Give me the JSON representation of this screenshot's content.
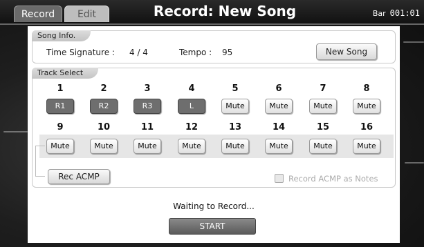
{
  "header": {
    "tabs": [
      {
        "label": "Record",
        "active": true
      },
      {
        "label": "Edit",
        "active": false
      }
    ],
    "title": "Record: New Song",
    "bar_label": "Bar",
    "bar_value": "001:01"
  },
  "song_info": {
    "section_label": "Song Info.",
    "time_signature_label": "Time Signature :",
    "time_signature_value": "4 / 4",
    "tempo_label": "Tempo :",
    "tempo_value": "95",
    "new_song_label": "New Song"
  },
  "track_select": {
    "section_label": "Track Select",
    "row1": {
      "numbers": [
        "1",
        "2",
        "3",
        "4",
        "5",
        "6",
        "7",
        "8"
      ],
      "buttons": [
        "R1",
        "R2",
        "R3",
        "L",
        "Mute",
        "Mute",
        "Mute",
        "Mute"
      ]
    },
    "row2": {
      "numbers": [
        "9",
        "10",
        "11",
        "12",
        "13",
        "14",
        "15",
        "16"
      ],
      "buttons": [
        "Mute",
        "Mute",
        "Mute",
        "Mute",
        "Mute",
        "Mute",
        "Mute",
        "Mute"
      ]
    },
    "rec_acmp_label": "Rec ACMP",
    "record_acmp_notes_label": "Record ACMP as Notes"
  },
  "status_text": "Waiting to Record...",
  "start_label": "START",
  "colors": {
    "assigned_button": "#6e6e6e",
    "panel": "#ffffff",
    "header": "#111111"
  }
}
